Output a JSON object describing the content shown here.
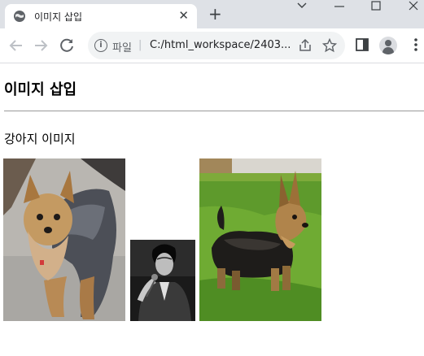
{
  "browser": {
    "tab_title": "이미지 삽입",
    "url_scheme_label": "파일",
    "url": "C:/html_workspace/2403...",
    "new_tab_label": "+",
    "close_tab_label": "✕"
  },
  "page": {
    "heading": "이미지 삽입",
    "caption": "강아지 이미지",
    "images": [
      {
        "subject": "yorkshire-terrier-on-pavement"
      },
      {
        "subject": "man-singing-black-and-white"
      },
      {
        "subject": "silky-terrier-on-grass"
      }
    ]
  },
  "icons": [
    "globe-icon",
    "close-icon",
    "plus-icon",
    "chevron-down-icon",
    "minimize-icon",
    "maximize-icon",
    "window-close-icon",
    "back-arrow-icon",
    "forward-arrow-icon",
    "reload-icon",
    "info-icon",
    "share-icon",
    "star-icon",
    "side-panel-icon",
    "profile-icon",
    "kebab-menu-icon"
  ]
}
